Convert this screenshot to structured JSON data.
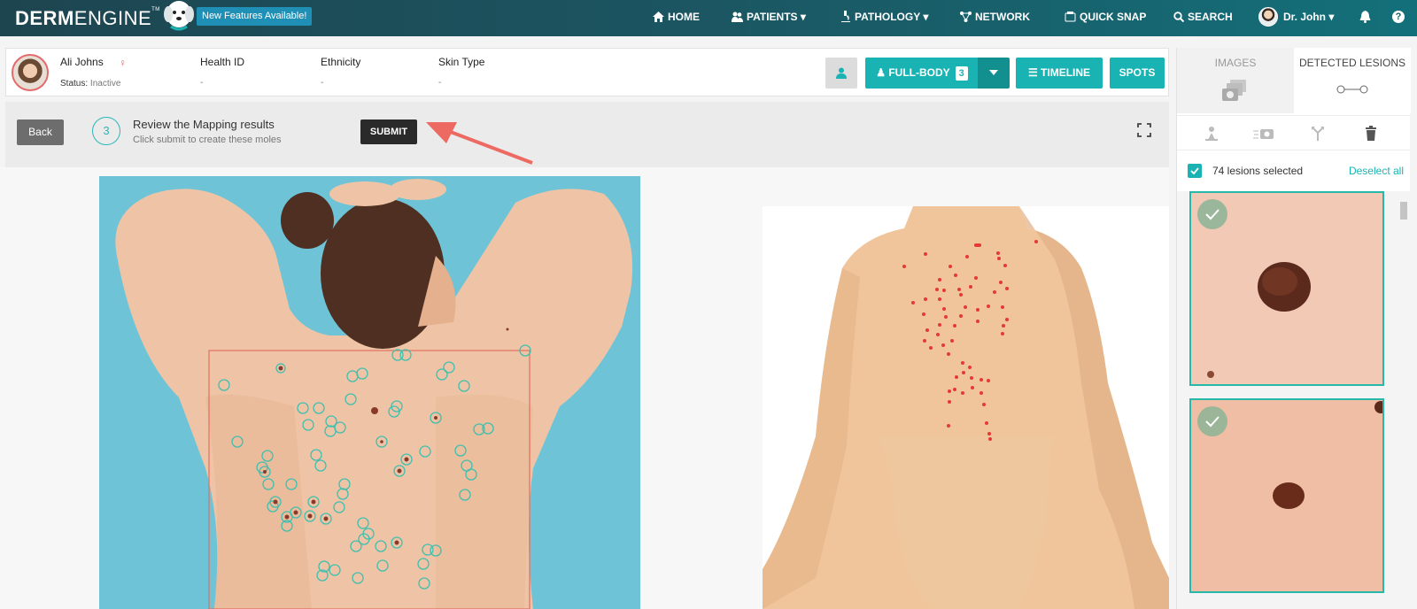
{
  "app": {
    "logo_bold": "DERM",
    "logo_light": "ENGINE",
    "logo_tm": "TM",
    "new_features": "New Features Available!"
  },
  "nav": {
    "home": "HOME",
    "patients": "PATIENTS",
    "pathology": "PATHOLOGY",
    "network": "NETWORK",
    "quick_snap": "QUICK SNAP",
    "search": "SEARCH",
    "user": "Dr. John",
    "help": "?"
  },
  "patient": {
    "name": "Ali Johns",
    "status_label": "Status:",
    "status_value": "Inactive",
    "health_id_label": "Health ID",
    "health_id_value": "-",
    "ethnicity_label": "Ethnicity",
    "ethnicity_value": "-",
    "skin_type_label": "Skin Type",
    "skin_type_value": "-"
  },
  "actions": {
    "full_body": "FULL-BODY",
    "full_body_count": "3",
    "timeline": "TIMELINE",
    "spots": "SPOTS"
  },
  "step": {
    "back": "Back",
    "number": "3",
    "title": "Review the Mapping results",
    "subtitle": "Click submit to create these moles",
    "submit": "SUBMIT"
  },
  "right_panel": {
    "tab_images": "IMAGES",
    "tab_detected": "DETECTED LESIONS",
    "selected_text": "74 lesions selected",
    "deselect_all": "Deselect all"
  },
  "colors": {
    "accent": "#1ab3b3",
    "nav_dark": "#1d4550",
    "marker": "#e53935",
    "circle": "#4fc0b0"
  }
}
